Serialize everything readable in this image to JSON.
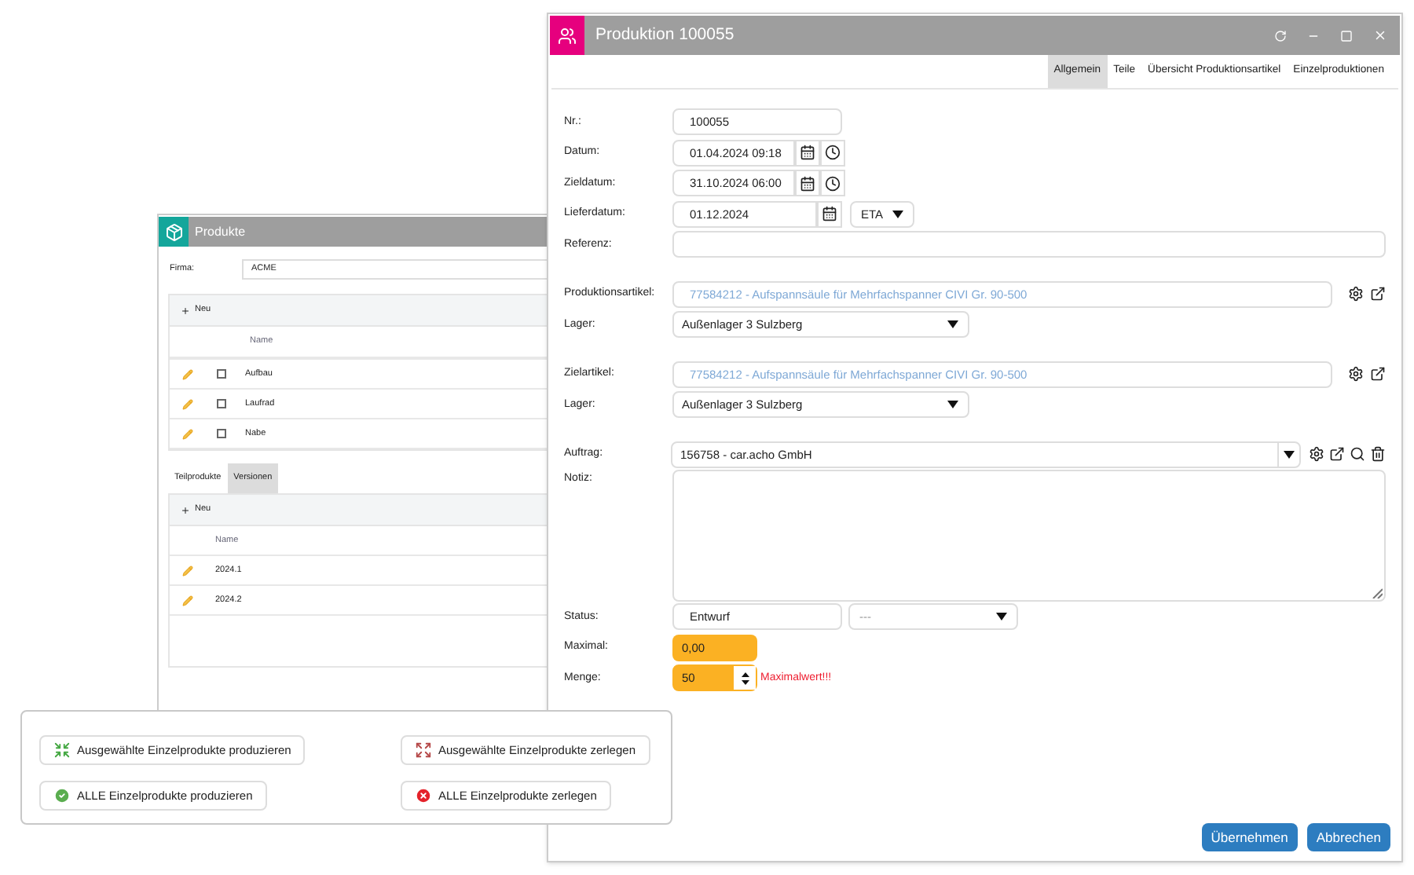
{
  "products_window": {
    "title": "Produkte",
    "company": {
      "label": "Firma:",
      "value": "ACME"
    },
    "parts": {
      "new_button": "Neu",
      "columns": [
        "Name"
      ],
      "rows": [
        {
          "name": "Aufbau",
          "checked": false
        },
        {
          "name": "Laufrad",
          "checked": false
        },
        {
          "name": "Nabe",
          "checked": false
        }
      ]
    },
    "tabs": [
      {
        "label": "Teilprodukte",
        "selected": false
      },
      {
        "label": "Versionen",
        "selected": true
      }
    ],
    "versions": {
      "new_button": "Neu",
      "columns": [
        "Name"
      ],
      "rows": [
        {
          "name": "2024.1"
        },
        {
          "name": "2024.2"
        }
      ]
    }
  },
  "actions": [
    {
      "label": "Ausgewählte Einzelprodukte produzieren",
      "kind": "produce_selected"
    },
    {
      "label": "Ausgewählte Einzelprodukte zerlegen",
      "kind": "disassemble_selected"
    },
    {
      "label": "ALLE Einzelprodukte produzieren",
      "kind": "produce_all"
    },
    {
      "label": "ALLE Einzelprodukte zerlegen",
      "kind": "disassemble_all"
    }
  ],
  "production_window": {
    "title": "Produktion 100055",
    "tabs": [
      {
        "label": "Allgemein",
        "selected": true
      },
      {
        "label": "Teile",
        "selected": false
      },
      {
        "label": "Übersicht Produktionsartikel",
        "selected": false
      },
      {
        "label": "Einzelproduktionen",
        "selected": false
      }
    ],
    "sections": [
      [
        {
          "kind": "text",
          "label": "Nr.:",
          "value": "100055"
        },
        {
          "kind": "datetime",
          "label": "Datum:",
          "value": "01.04.2024 09:18"
        },
        {
          "kind": "datetime",
          "label": "Zieldatum:",
          "value": "31.10.2024 06:00"
        },
        {
          "kind": "date_select",
          "label": "Lieferdatum:",
          "value": "01.12.2024",
          "option": "ETA"
        },
        {
          "kind": "wide",
          "label": "Referenz:"
        }
      ],
      [
        {
          "kind": "lookup",
          "label": "Produktionsartikel:",
          "value": "77584212 - Aufspannsäule für Mehrfachspanner CIVI Gr. 90-500"
        },
        {
          "kind": "select",
          "label": "Lager:",
          "value": "Außenlager 3 Sulzberg"
        }
      ],
      [
        {
          "kind": "lookup",
          "label": "Zielartikel:",
          "value": "77584212 - Aufspannsäule für Mehrfachspanner CIVI Gr. 90-500"
        },
        {
          "kind": "select",
          "label": "Lager:",
          "value": "Außenlager 3 Sulzberg"
        }
      ],
      [
        {
          "kind": "lookup_select",
          "label": "Auftrag:",
          "value": "156758 - car.acho GmbH"
        },
        {
          "kind": "textarea",
          "label": "Notiz:"
        },
        {
          "kind": "text_select",
          "label": "Status:",
          "value": "Entwurf",
          "option": "---"
        },
        {
          "kind": "highlight",
          "label": "Maximal:",
          "value": "0,00"
        },
        {
          "kind": "spinner",
          "label": "Menge:",
          "value": "50",
          "warning": "Maximalwert!!!"
        }
      ]
    ],
    "buttons": [
      "Übernehmen",
      "Abbrechen"
    ]
  }
}
